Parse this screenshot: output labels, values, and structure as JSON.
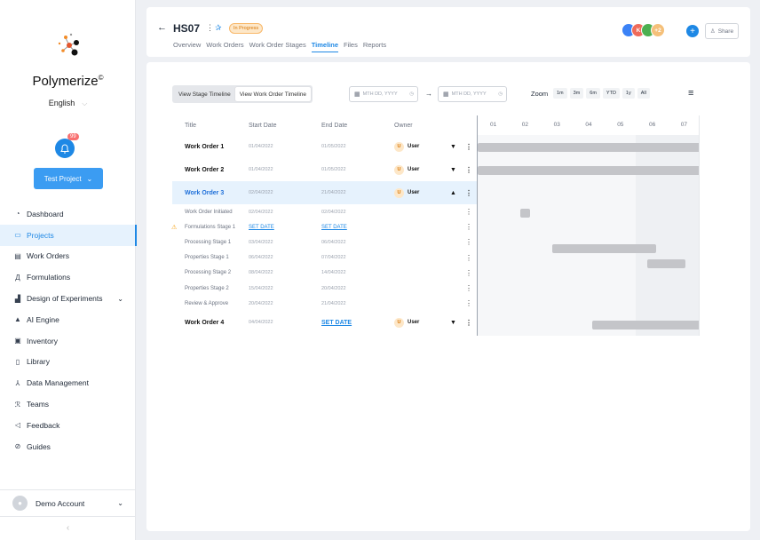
{
  "sidebar": {
    "brand": "Polymerize",
    "brand_mark": "©",
    "language": "English",
    "notification_count": "99",
    "project_button": "Test Project",
    "items": [
      {
        "label": "Dashboard",
        "icon": "dashboard-icon",
        "glyph": "◔"
      },
      {
        "label": "Projects",
        "icon": "folder-icon",
        "glyph": "▭",
        "active": true
      },
      {
        "label": "Work Orders",
        "icon": "document-icon",
        "glyph": "▤"
      },
      {
        "label": "Formulations",
        "icon": "flask-icon",
        "glyph": "Д"
      },
      {
        "label": "Design of Experiments",
        "icon": "chart-icon",
        "glyph": "▟",
        "expandable": true
      },
      {
        "label": "AI Engine",
        "icon": "ai-icon",
        "glyph": "▲"
      },
      {
        "label": "Inventory",
        "icon": "inventory-icon",
        "glyph": "▣"
      },
      {
        "label": "Library",
        "icon": "library-icon",
        "glyph": "▯"
      },
      {
        "label": "Data Management",
        "icon": "data-management-icon",
        "glyph": "⅄"
      },
      {
        "label": "Teams",
        "icon": "teams-icon",
        "glyph": "ℛ"
      },
      {
        "label": "Feedback",
        "icon": "feedback-icon",
        "glyph": "◁"
      },
      {
        "label": "Guides",
        "icon": "guides-icon",
        "glyph": "⊘"
      }
    ],
    "account": "Demo Account"
  },
  "header": {
    "title": "HS07",
    "status": "In Progress",
    "tabs": [
      "Overview",
      "Work Orders",
      "Work Order Stages",
      "Timeline",
      "Files",
      "Reports"
    ],
    "active_tab": "Timeline",
    "avatars": [
      {
        "text": "",
        "color": "#3b82f6"
      },
      {
        "text": "K",
        "color": "#ef6b5b"
      },
      {
        "text": "",
        "color": "#4caf50"
      },
      {
        "text": "+2",
        "color": "#f5c07a"
      }
    ],
    "share": "Share"
  },
  "toolbar": {
    "view_stage": "View Stage Timeline",
    "view_work_order": "View Work Order Timeline",
    "date_placeholder_from": "MTH DD, YYYY",
    "date_placeholder_to": "MTH DD, YYYY",
    "zoom_label": "Zoom",
    "zoom_options": [
      "1m",
      "3m",
      "6m",
      "YTD",
      "1y",
      "All"
    ]
  },
  "table": {
    "headers": {
      "title": "Title",
      "start": "Start Date",
      "end": "End Date",
      "owner": "Owner"
    },
    "rows": [
      {
        "type": "main",
        "title": "Work Order 1",
        "start": "01/04/2022",
        "end": "01/05/2022",
        "owner": "User",
        "owner_initial": "U",
        "expanded": false
      },
      {
        "type": "main",
        "title": "Work Order 2",
        "start": "01/04/2022",
        "end": "01/05/2022",
        "owner": "User",
        "owner_initial": "U",
        "expanded": false
      },
      {
        "type": "main",
        "title": "Work Order 3",
        "start": "02/04/2022",
        "end": "21/04/2022",
        "owner": "User",
        "owner_initial": "U",
        "expanded": true,
        "selected": true
      },
      {
        "type": "sub",
        "title": "Work Order Initiated",
        "start": "02/04/2022",
        "end": "02/04/2022"
      },
      {
        "type": "sub",
        "title": "Formulations Stage 1",
        "start": "SET DATE",
        "end": "SET DATE",
        "warning": true
      },
      {
        "type": "sub",
        "title": "Processing Stage 1",
        "start": "03/04/2022",
        "end": "06/04/2022"
      },
      {
        "type": "sub",
        "title": "Properties Stage 1",
        "start": "06/04/2022",
        "end": "07/04/2022"
      },
      {
        "type": "sub",
        "title": "Processing Stage 2",
        "start": "08/04/2022",
        "end": "14/04/2022"
      },
      {
        "type": "sub",
        "title": "Properties Stage 2",
        "start": "15/04/2022",
        "end": "20/04/2022"
      },
      {
        "type": "sub",
        "title": "Review & Approve",
        "start": "20/04/2022",
        "end": "21/04/2022"
      },
      {
        "type": "main",
        "title": "Work Order 4",
        "start": "04/04/2022",
        "end": "SET DATE",
        "owner": "User",
        "owner_initial": "U",
        "expanded": false
      }
    ]
  },
  "gantt": {
    "columns": [
      "01",
      "02",
      "03",
      "04",
      "05",
      "06",
      "07"
    ]
  }
}
